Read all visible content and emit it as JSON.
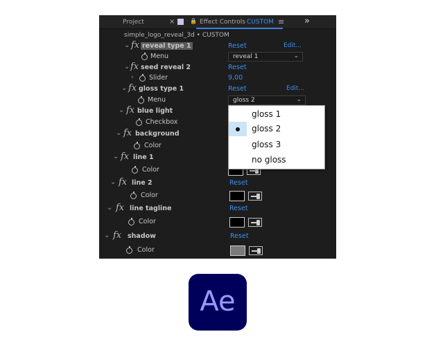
{
  "tabs": {
    "project": "Project",
    "close_glyph": "×",
    "effect_controls": "Effect Controls",
    "custom": "CUSTOM",
    "menu_glyph": "≡",
    "expand_glyph": "»"
  },
  "comp_title": "simple_logo_reveal_3d • CUSTOM",
  "effects": [
    {
      "name": "reveal type 1",
      "reset": "Reset",
      "edit": "Edit...",
      "prop": "Menu",
      "value": "reveal 1"
    },
    {
      "name": "seed reveal 2",
      "reset": "Reset",
      "prop": "Slider",
      "value": "9,00"
    },
    {
      "name": "gloss type 1",
      "reset": "Reset",
      "edit": "Edit...",
      "prop": "Menu",
      "value": "gloss 2"
    },
    {
      "name": "blue light",
      "prop": "Checkbox"
    },
    {
      "name": "background",
      "prop": "Color"
    },
    {
      "name": "line 1",
      "prop": "Color"
    },
    {
      "name": "line 2",
      "reset": "Reset",
      "prop": "Color"
    },
    {
      "name": "line tagline",
      "reset": "Reset",
      "prop": "Color"
    },
    {
      "name": "shadow",
      "reset": "Reset",
      "prop": "Color"
    }
  ],
  "dropdown": {
    "items": [
      "gloss 1",
      "gloss 2",
      "gloss 3",
      "no gloss"
    ],
    "selected": "gloss 2"
  },
  "colors": {
    "accent_blue": "#3a91f2",
    "swatch_black": "#000000",
    "swatch_gray": "#7a7a7a",
    "highlight": "#cce4f7",
    "logo_bg": "#00005b",
    "logo_text": "#9999ff"
  },
  "logo": {
    "text": "Ae"
  }
}
